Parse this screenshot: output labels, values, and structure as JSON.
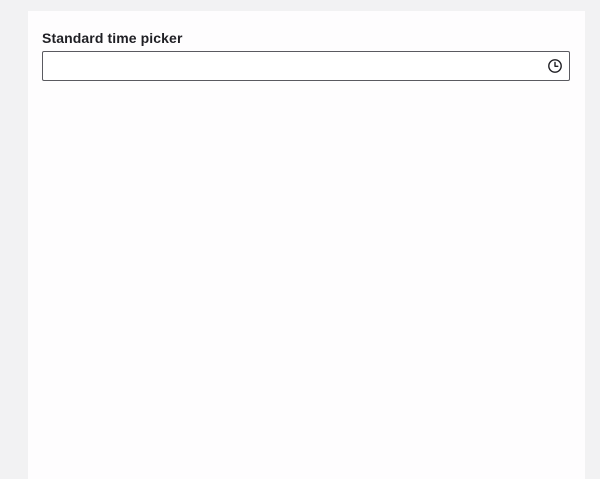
{
  "field": {
    "label": "Standard time picker",
    "value": "",
    "placeholder": ""
  },
  "icons": {
    "picker_toggle": "clock-icon"
  },
  "colors": {
    "background": "#f2f2f3",
    "panel": "#fefdfe",
    "border": "#5a5a60",
    "text": "#1f1f24"
  }
}
